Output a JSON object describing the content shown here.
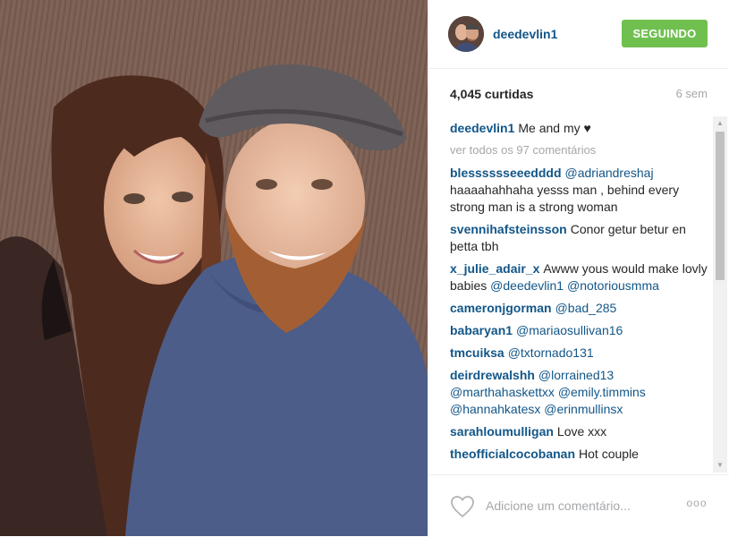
{
  "post": {
    "username": "deedevlin1",
    "follow_label": "SEGUINDO",
    "likes": "4,045 curtidas",
    "time": "6 sem",
    "caption": {
      "user": "deedevlin1",
      "text": "Me and my",
      "heart": "♥"
    },
    "view_all": "ver todos os 97 comentários",
    "comments": [
      {
        "user": "blesssssseeedddd",
        "parts": [
          {
            "t": "@adriandreshaj",
            "m": true
          },
          {
            "t": " haaaahahhaha yesss man , behind every strong man is a strong woman"
          }
        ]
      },
      {
        "user": "svennihafsteinsson",
        "parts": [
          {
            "t": "Conor getur betur en þetta tbh"
          }
        ]
      },
      {
        "user": "x_julie_adair_x",
        "parts": [
          {
            "t": "Awww yous would make lovly babies "
          },
          {
            "t": "@deedevlin1",
            "m": true
          },
          {
            "t": " "
          },
          {
            "t": "@notoriousmma",
            "m": true
          }
        ]
      },
      {
        "user": "cameronjgorman",
        "parts": [
          {
            "t": "@bad_285",
            "m": true
          }
        ]
      },
      {
        "user": "babaryan1",
        "parts": [
          {
            "t": "@mariaosullivan16",
            "m": true
          }
        ]
      },
      {
        "user": "tmcuiksa",
        "parts": [
          {
            "t": "@txtornado131",
            "m": true
          }
        ]
      },
      {
        "user": "deirdrewalshh",
        "parts": [
          {
            "t": "@lorrained13",
            "m": true
          },
          {
            "t": " "
          },
          {
            "t": "@marthahaskettxx",
            "m": true
          },
          {
            "t": " "
          },
          {
            "t": "@emily.timmins",
            "m": true
          },
          {
            "t": " "
          },
          {
            "t": "@hannahkatesx",
            "m": true
          },
          {
            "t": " "
          },
          {
            "t": "@erinmullinsx",
            "m": true
          }
        ]
      },
      {
        "user": "sarahloumulligan",
        "parts": [
          {
            "t": "Love xxx"
          }
        ]
      },
      {
        "user": "theofficialcocobanan",
        "parts": [
          {
            "t": "Hot couple"
          }
        ]
      }
    ],
    "comment_placeholder": "Adicione um comentário...",
    "more_label": "ooo"
  },
  "colors": {
    "username": "#125688",
    "follow_button": "#70c050",
    "muted_text": "#a5a7aa"
  },
  "icons": {
    "like": "heart-outline-icon",
    "more": "more-options-icon",
    "scroll_up": "scroll-up-arrow-icon",
    "scroll_down": "scroll-down-arrow-icon"
  }
}
